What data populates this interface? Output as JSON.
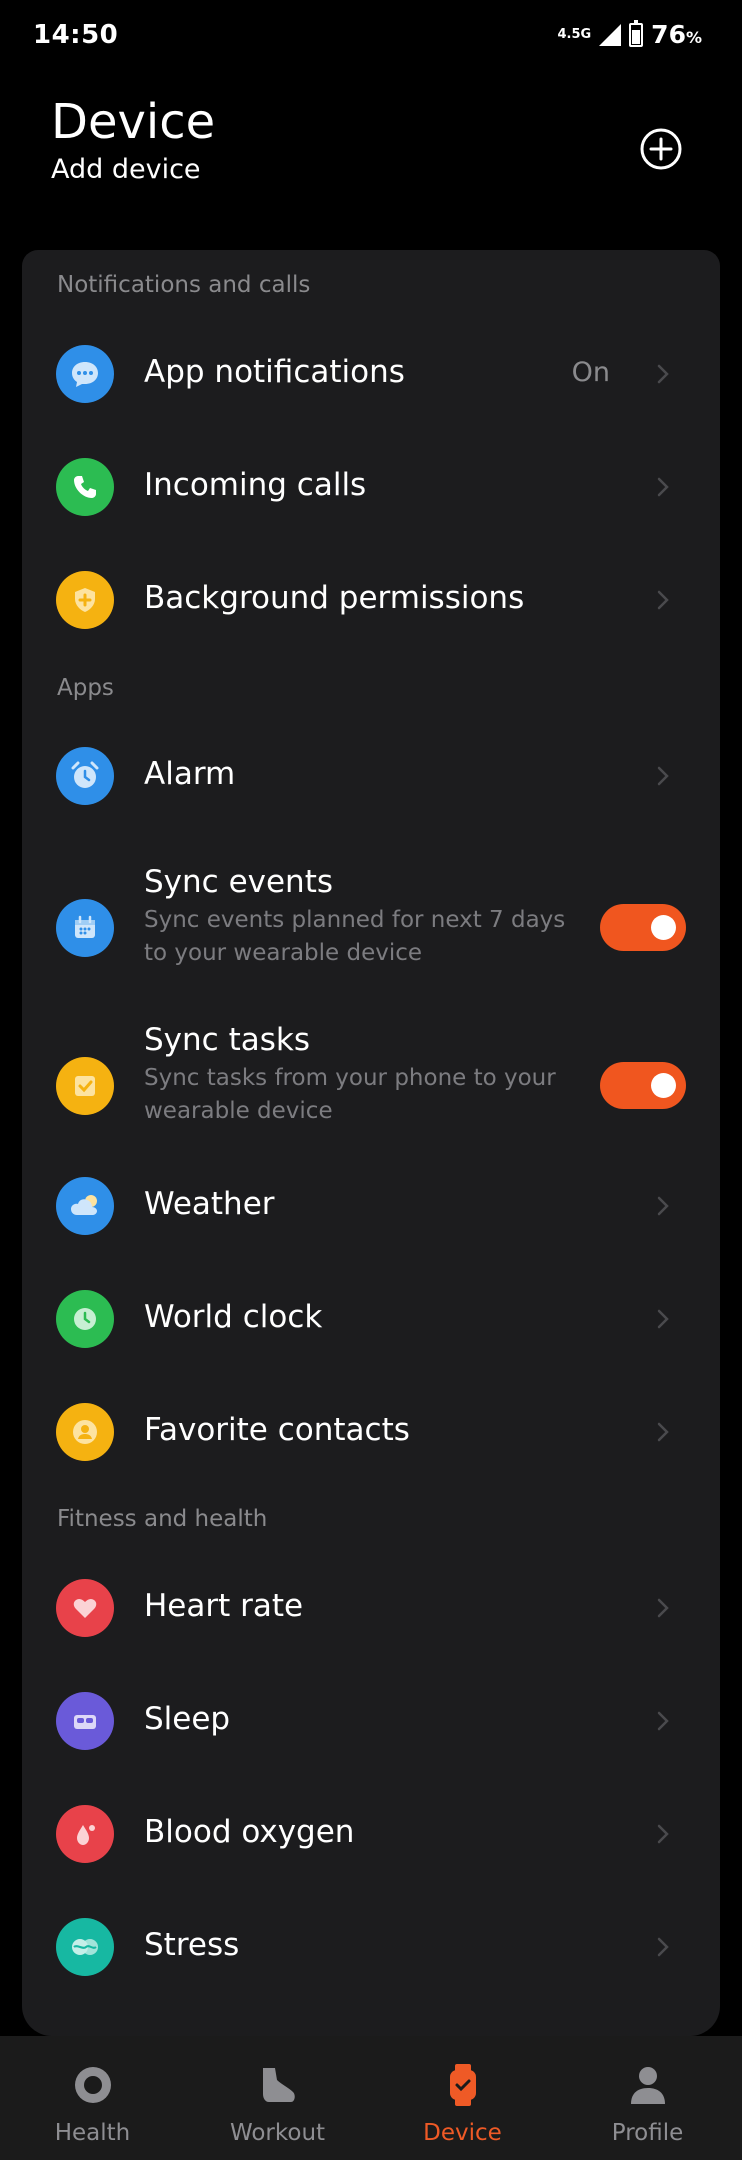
{
  "status_bar": {
    "time": "14:50",
    "network": "4.5G",
    "battery": "76",
    "battery_unit": "%"
  },
  "header": {
    "title": "Device",
    "subtitle": "Add device",
    "add_icon": "plus-circle-icon"
  },
  "sections": {
    "notifications": "Notifications and calls",
    "apps": "Apps",
    "fitness": "Fitness and health"
  },
  "rows": {
    "app_notifications": {
      "title": "App notifications",
      "value": "On",
      "icon": "chat-bubble-icon",
      "color": "#2f8fe8"
    },
    "incoming_calls": {
      "title": "Incoming calls",
      "icon": "phone-icon",
      "color": "#2cbc52"
    },
    "background_permissions": {
      "title": "Background permissions",
      "icon": "shield-plus-icon",
      "color": "#f5b211"
    },
    "alarm": {
      "title": "Alarm",
      "icon": "alarm-clock-icon",
      "color": "#2f8fe8"
    },
    "sync_events": {
      "title": "Sync events",
      "subtitle": "Sync events planned for next 7 days to your wearable device",
      "icon": "calendar-icon",
      "color": "#2f8fe8",
      "enabled": true
    },
    "sync_tasks": {
      "title": "Sync tasks",
      "subtitle": "Sync tasks from your phone to your wearable device",
      "icon": "task-check-icon",
      "color": "#f5b211",
      "enabled": true
    },
    "weather": {
      "title": "Weather",
      "icon": "weather-cloud-icon",
      "color": "#2f8fe8"
    },
    "world_clock": {
      "title": "World clock",
      "icon": "clock-icon",
      "color": "#2cbc52"
    },
    "favorite_contacts": {
      "title": "Favorite contacts",
      "icon": "contact-person-icon",
      "color": "#f5b211"
    },
    "heart_rate": {
      "title": "Heart rate",
      "icon": "heart-icon",
      "color": "#e8424a"
    },
    "sleep": {
      "title": "Sleep",
      "icon": "bed-icon",
      "color": "#6a5ad9"
    },
    "blood_oxygen": {
      "title": "Blood oxygen",
      "icon": "drop-icon",
      "color": "#e8424a"
    },
    "stress": {
      "title": "Stress",
      "icon": "stress-icon",
      "color": "#17b8a2"
    }
  },
  "nav": {
    "health": "Health",
    "workout": "Workout",
    "device": "Device",
    "profile": "Profile",
    "active": "Device",
    "active_color": "#ef5a26"
  }
}
